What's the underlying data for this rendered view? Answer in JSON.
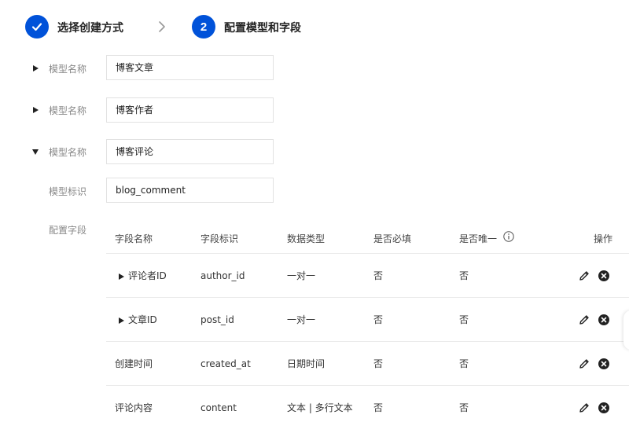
{
  "stepper": {
    "step1_title": "选择创建方式",
    "step2_number": "2",
    "step2_title": "配置模型和字段"
  },
  "models": [
    {
      "label": "模型名称",
      "value": "博客文章",
      "expanded": false
    },
    {
      "label": "模型名称",
      "value": "博客作者",
      "expanded": false
    },
    {
      "label": "模型名称",
      "value": "博客评论",
      "expanded": true
    }
  ],
  "identifier": {
    "label": "模型标识",
    "value": "blog_comment"
  },
  "fields_config": {
    "label": "配置字段",
    "headers": {
      "name": "字段名称",
      "key": "字段标识",
      "type": "数据类型",
      "required": "是否必填",
      "unique": "是否唯一",
      "actions": "操作"
    },
    "rows": [
      {
        "name": "评论者ID",
        "key": "author_id",
        "type": "一对一",
        "required": "否",
        "unique": "否",
        "expandable": true
      },
      {
        "name": "文章ID",
        "key": "post_id",
        "type": "一对一",
        "required": "否",
        "unique": "否",
        "expandable": true
      },
      {
        "name": "创建时间",
        "key": "created_at",
        "type": "日期时间",
        "required": "否",
        "unique": "否",
        "expandable": false
      },
      {
        "name": "评论内容",
        "key": "content",
        "type": "文本 | 多行文本",
        "required": "否",
        "unique": "否",
        "expandable": false
      }
    ]
  },
  "icons": {
    "step1": "check-icon",
    "step_separator": "chevron-right-icon",
    "collapsed": "caret-right-icon",
    "expanded": "caret-down-icon",
    "info": "info-icon",
    "edit": "pencil-icon",
    "delete": "close-circle-icon"
  },
  "colors": {
    "primary": "#0052d9",
    "label": "#888888",
    "border": "#e2e2e2"
  }
}
